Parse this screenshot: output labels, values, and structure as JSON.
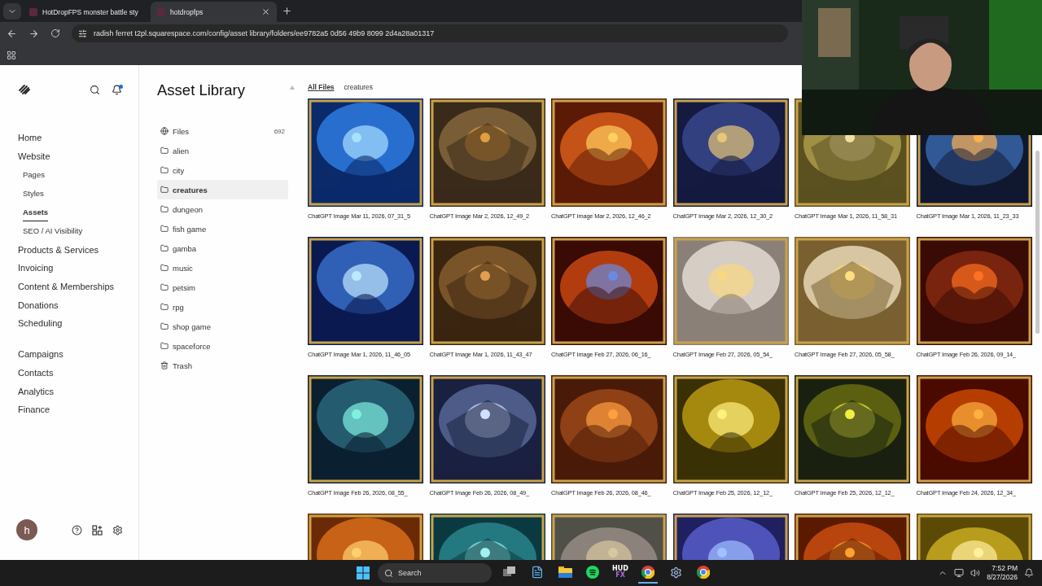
{
  "browser": {
    "tabs": [
      {
        "title": "HotDropFPS monster battle sty",
        "selected": false
      },
      {
        "title": "hotdropfps",
        "selected": true
      }
    ],
    "address": "radish ferret t2pl.squarespace.com/config/asset library/folders/ee9782a5 0d56 49b9 8099 2d4a28a01317"
  },
  "nav": {
    "groups": [
      {
        "items": [
          {
            "label": "Home",
            "selected": false
          },
          {
            "label": "Website",
            "selected": false,
            "children": [
              {
                "label": "Pages",
                "selected": false
              },
              {
                "label": "Styles",
                "selected": false
              },
              {
                "label": "Assets",
                "selected": true
              },
              {
                "label": "SEO / AI Visibility",
                "selected": false
              }
            ]
          },
          {
            "label": "Products & Services",
            "selected": false
          },
          {
            "label": "Invoicing",
            "selected": false
          },
          {
            "label": "Content & Memberships",
            "selected": false
          },
          {
            "label": "Donations",
            "selected": false
          },
          {
            "label": "Scheduling",
            "selected": false
          }
        ]
      },
      {
        "items": [
          {
            "label": "Campaigns",
            "selected": false
          },
          {
            "label": "Contacts",
            "selected": false
          },
          {
            "label": "Analytics",
            "selected": false
          },
          {
            "label": "Finance",
            "selected": false
          }
        ]
      }
    ],
    "avatar": "h"
  },
  "library": {
    "title": "Asset Library",
    "folders": [
      {
        "kind": "all",
        "label": "Files",
        "count": "692",
        "selected": false
      },
      {
        "kind": "folder",
        "label": "alien",
        "selected": false
      },
      {
        "kind": "folder",
        "label": "city",
        "selected": false
      },
      {
        "kind": "folder",
        "label": "creatures",
        "selected": true
      },
      {
        "kind": "folder",
        "label": "dungeon",
        "selected": false
      },
      {
        "kind": "folder",
        "label": "fish game",
        "selected": false
      },
      {
        "kind": "folder",
        "label": "gamba",
        "selected": false
      },
      {
        "kind": "folder",
        "label": "music",
        "selected": false
      },
      {
        "kind": "folder",
        "label": "petsim",
        "selected": false
      },
      {
        "kind": "folder",
        "label": "rpg",
        "selected": false
      },
      {
        "kind": "folder",
        "label": "shop game",
        "selected": false
      },
      {
        "kind": "folder",
        "label": "spaceforce",
        "selected": false
      },
      {
        "kind": "trash",
        "label": "Trash",
        "selected": false
      }
    ]
  },
  "breadcrumb": [
    {
      "label": "All Files",
      "selected": true
    },
    {
      "label": "creatures",
      "selected": false
    }
  ],
  "files": [
    {
      "kind": "picture",
      "caption": "ChatGPT Image Mar 11, 2026, 07_31_5"
    },
    {
      "kind": "picture",
      "caption": "ChatGPT Image Mar 2, 2026, 12_49_2"
    },
    {
      "kind": "picture",
      "caption": "ChatGPT Image Mar 2, 2026, 12_46_2"
    },
    {
      "kind": "picture",
      "caption": "ChatGPT Image Mar 2, 2026, 12_30_2"
    },
    {
      "kind": "picture",
      "caption": "ChatGPT Image Mar 1, 2026, 11_58_31"
    },
    {
      "kind": "picture",
      "caption": "ChatGPT Image Mar 1, 2026, 11_23_33"
    },
    {
      "kind": "picture",
      "caption": "ChatGPT Image Mar 1, 2026, 11_46_05"
    },
    {
      "kind": "picture",
      "caption": "ChatGPT Image Mar 1, 2026, 11_43_47"
    },
    {
      "kind": "picture",
      "caption": "ChatGPT Image Feb 27, 2026, 06_16_"
    },
    {
      "kind": "picture",
      "caption": "ChatGPT Image Feb 27, 2026, 05_54_"
    },
    {
      "kind": "picture",
      "caption": "ChatGPT Image Feb 27, 2026, 05_58_"
    },
    {
      "kind": "picture",
      "caption": "ChatGPT Image Feb 26, 2026, 09_14_"
    },
    {
      "kind": "picture",
      "caption": "ChatGPT Image Feb 26, 2026, 08_55_"
    },
    {
      "kind": "picture",
      "caption": "ChatGPT Image Feb 26, 2026, 08_49_"
    },
    {
      "kind": "picture",
      "caption": "ChatGPT Image Feb 26, 2026, 08_46_"
    },
    {
      "kind": "picture",
      "caption": "ChatGPT Image Feb 25, 2026, 12_12_"
    },
    {
      "kind": "picture",
      "caption": "ChatGPT Image Feb 25, 2026, 12_12_"
    },
    {
      "kind": "picture",
      "caption": "ChatGPT Image Feb 24, 2026, 12_34_"
    },
    {
      "kind": "picture"
    },
    {
      "kind": "picture"
    },
    {
      "kind": "picture"
    },
    {
      "kind": "picture"
    },
    {
      "kind": "picture"
    },
    {
      "kind": "picture"
    }
  ],
  "webcam": {
    "kind": "picture"
  },
  "taskbar": {
    "search": "Search",
    "apps": [
      {
        "kind": "taskview",
        "selected": false
      },
      {
        "kind": "notepad",
        "selected": false
      },
      {
        "kind": "files",
        "selected": false
      },
      {
        "kind": "spotify",
        "selected": false
      },
      {
        "kind": "hud",
        "top": "HUD",
        "bottom": "FX",
        "selected": false
      },
      {
        "kind": "chrome",
        "selected": true
      },
      {
        "kind": "gear",
        "selected": false
      },
      {
        "kind": "chrome",
        "selected": false
      }
    ],
    "time": "7:52 PM",
    "date": "8/27/2026"
  }
}
